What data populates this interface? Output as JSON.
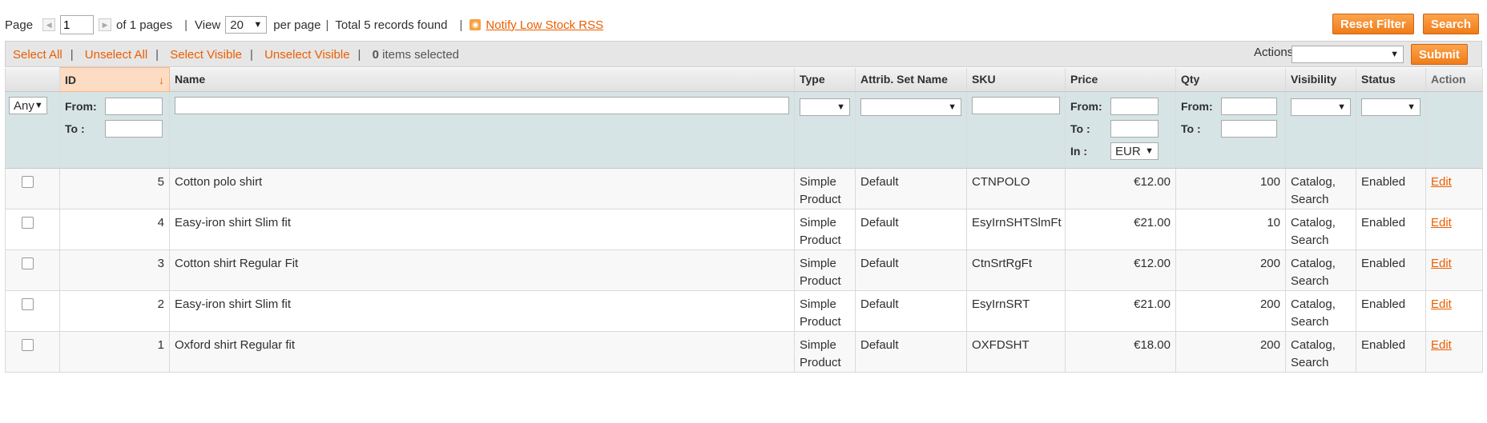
{
  "pager": {
    "page_label": "Page",
    "current_page": "1",
    "of_pages": "of 1 pages",
    "view_label": "View",
    "per_page_value": "20",
    "per_page_label": "per page",
    "total": "Total 5 records found",
    "rss_label": "Notify Low Stock RSS"
  },
  "buttons": {
    "reset": "Reset Filter",
    "search": "Search",
    "submit": "Submit"
  },
  "massaction": {
    "select_all": "Select All",
    "unselect_all": "Unselect All",
    "select_visible": "Select Visible",
    "unselect_visible": "Unselect Visible",
    "count": "0",
    "count_label": "items selected",
    "actions_label": "Actions",
    "actions_value": ""
  },
  "columns": {
    "id": "ID",
    "name": "Name",
    "type": "Type",
    "attrib_set": "Attrib. Set Name",
    "sku": "SKU",
    "price": "Price",
    "qty": "Qty",
    "visibility": "Visibility",
    "status": "Status",
    "action": "Action"
  },
  "filters": {
    "any": "Any",
    "from": "From:",
    "to": "To :",
    "in": "In :",
    "currency": "EUR"
  },
  "rows": [
    {
      "id": "5",
      "name": "Cotton polo shirt",
      "type1": "Simple",
      "type2": "Product",
      "attrib_set": "Default",
      "sku": "CTNPOLO",
      "price": "€12.00",
      "qty": "100",
      "vis1": "Catalog,",
      "vis2": "Search",
      "status": "Enabled",
      "action": "Edit"
    },
    {
      "id": "4",
      "name": "Easy-iron shirt Slim fit",
      "type1": "Simple",
      "type2": "Product",
      "attrib_set": "Default",
      "sku": "EsyIrnSHTSlmFt",
      "price": "€21.00",
      "qty": "10",
      "vis1": "Catalog,",
      "vis2": "Search",
      "status": "Enabled",
      "action": "Edit"
    },
    {
      "id": "3",
      "name": "Cotton shirt Regular Fit",
      "type1": "Simple",
      "type2": "Product",
      "attrib_set": "Default",
      "sku": "CtnSrtRgFt",
      "price": "€12.00",
      "qty": "200",
      "vis1": "Catalog,",
      "vis2": "Search",
      "status": "Enabled",
      "action": "Edit"
    },
    {
      "id": "2",
      "name": "Easy-iron shirt Slim fit",
      "type1": "Simple",
      "type2": "Product",
      "attrib_set": "Default",
      "sku": "EsyIrnSRT",
      "price": "€21.00",
      "qty": "200",
      "vis1": "Catalog,",
      "vis2": "Search",
      "status": "Enabled",
      "action": "Edit"
    },
    {
      "id": "1",
      "name": "Oxford shirt Regular fit",
      "type1": "Simple",
      "type2": "Product",
      "attrib_set": "Default",
      "sku": "OXFDSHT",
      "price": "€18.00",
      "qty": "200",
      "vis1": "Catalog,",
      "vis2": "Search",
      "status": "Enabled",
      "action": "Edit"
    }
  ],
  "colors": {
    "accent": "#eb5e00",
    "button": "#f07c18",
    "filter_bg": "#d6e4e6",
    "sorted_header": "#fcdcc2"
  },
  "icons": {
    "prev": "arrow-left-icon",
    "next": "arrow-right-icon",
    "rss": "rss-icon",
    "sort": "sort-down-icon"
  }
}
